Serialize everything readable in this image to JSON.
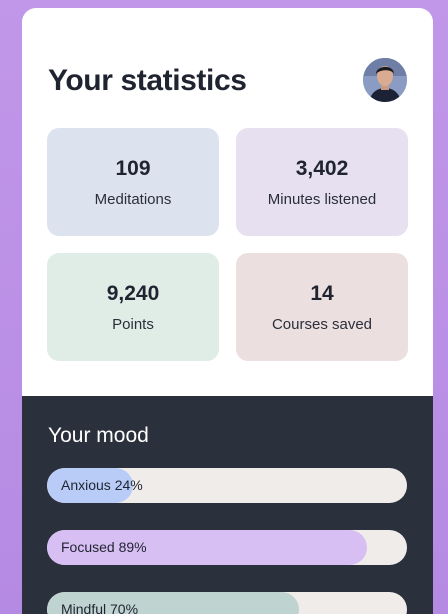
{
  "header": {
    "title": "Your statistics",
    "avatar_icon": "user-avatar"
  },
  "stats": [
    {
      "value": "109",
      "label": "Meditations",
      "color": "#dde3ee"
    },
    {
      "value": "3,402",
      "label": "Minutes listened",
      "color": "#e6e0f0"
    },
    {
      "value": "9,240",
      "label": "Points",
      "color": "#e0ede7"
    },
    {
      "value": "14",
      "label": "Courses saved",
      "color": "#ecdfdf"
    }
  ],
  "mood": {
    "title": "Your mood",
    "items": [
      {
        "label": "Anxious 24%",
        "value": 24,
        "color": "#b9ccf8"
      },
      {
        "label": "Focused 89%",
        "value": 89,
        "color": "#d7bff4"
      },
      {
        "label": "Mindful 70%",
        "value": 70,
        "color": "#bfd3d1"
      }
    ]
  }
}
